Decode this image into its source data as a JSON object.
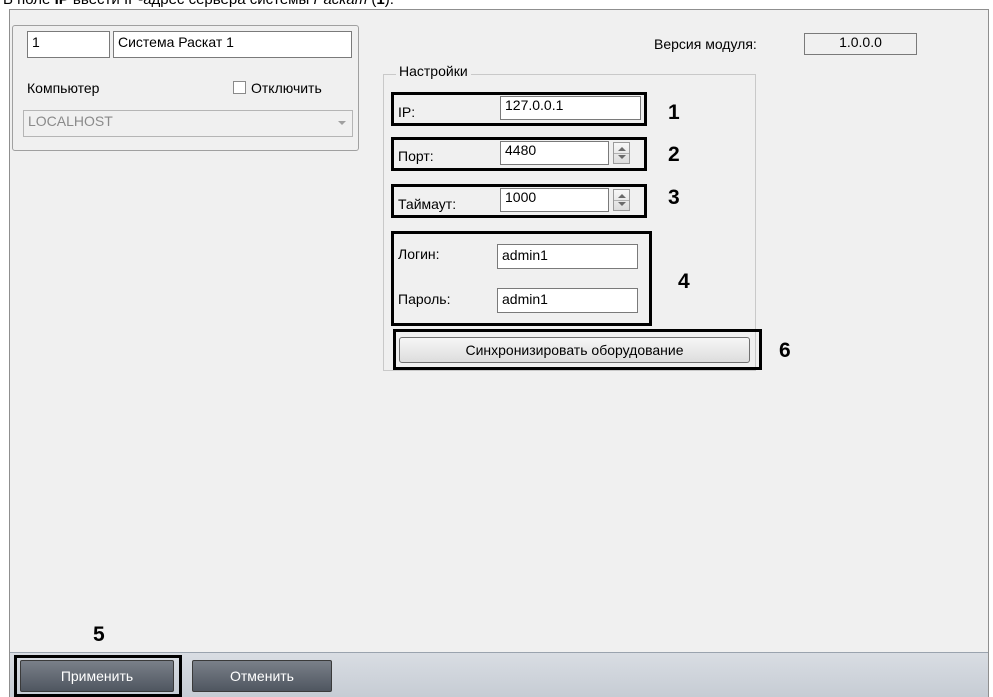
{
  "instruction": {
    "pre": "В поле ",
    "field_name": "IP",
    "mid": " ввести IP-адрес сервера системы ",
    "system_name": "Раскат",
    "post_open": " (",
    "marker": "1",
    "post_close": ")."
  },
  "object": {
    "id_value": "1",
    "name_value": "Система Раскат 1",
    "computer_label": "Компьютер",
    "disable_label": "Отключить",
    "computer_value": "LOCALHOST"
  },
  "module": {
    "version_label": "Версия модуля:",
    "version_value": "1.0.0.0"
  },
  "settings": {
    "group_title": "Настройки",
    "ip_label": "IP:",
    "ip_value": "127.0.0.1",
    "port_label": "Порт:",
    "port_value": "4480",
    "timeout_label": "Таймаут:",
    "timeout_value": "1000",
    "login_label": "Логин:",
    "login_value": "admin1",
    "password_label": "Пароль:",
    "password_value": "admin1",
    "sync_button": "Синхронизировать оборудование"
  },
  "callouts": {
    "n1": "1",
    "n2": "2",
    "n3": "3",
    "n4": "4",
    "n5": "5",
    "n6": "6"
  },
  "footer": {
    "apply_button": "Применить",
    "cancel_button": "Отменить"
  }
}
